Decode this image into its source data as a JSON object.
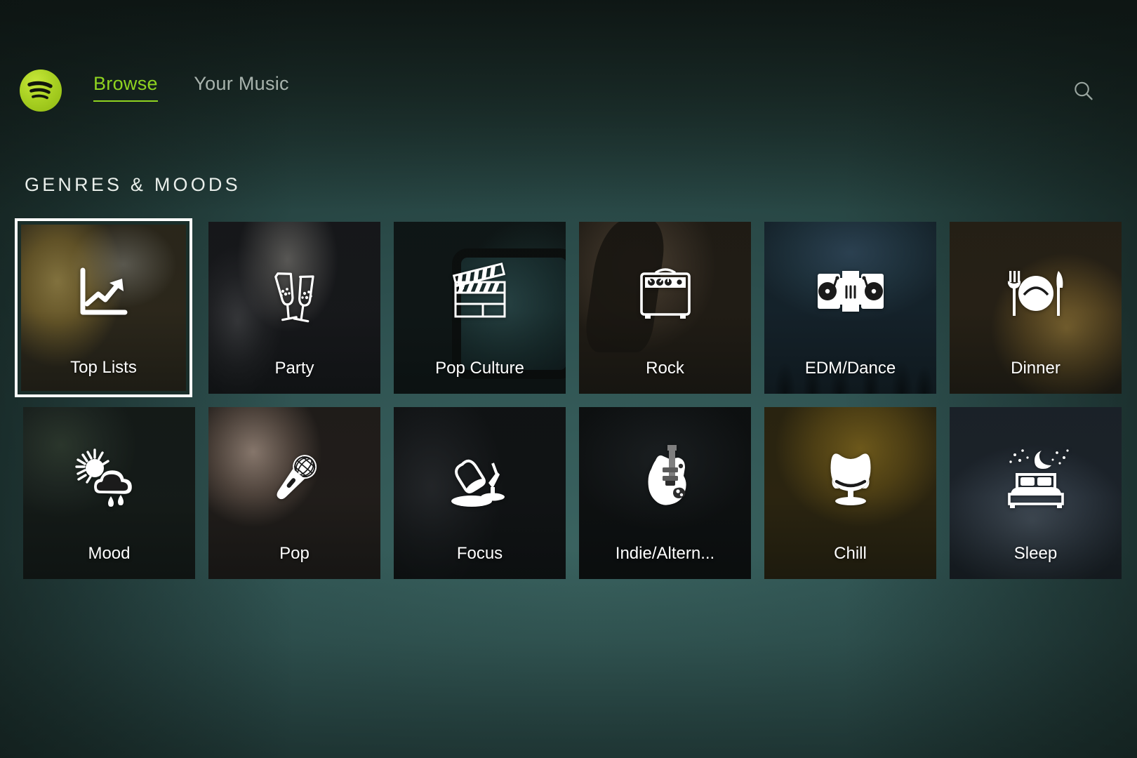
{
  "app": {
    "name": "Spotify",
    "logo_color": "#a8d022",
    "accent_color": "#8fd320",
    "background_color": "#2b4a46"
  },
  "header": {
    "logo_icon": "spotify-logo-icon",
    "nav": [
      {
        "label": "Browse",
        "active": true
      },
      {
        "label": "Your Music",
        "active": false
      }
    ],
    "search_icon": "search-icon"
  },
  "section": {
    "title": "GENRES & MOODS"
  },
  "grid": {
    "rows": [
      [
        {
          "label": "Top Lists",
          "icon": "chart-trend-up-icon",
          "photo": "ph-toplists",
          "selected": true
        },
        {
          "label": "Party",
          "icon": "champagne-glasses-icon",
          "photo": "ph-party",
          "selected": false
        },
        {
          "label": "Pop Culture",
          "icon": "clapperboard-icon",
          "photo": "ph-popculture",
          "selected": false
        },
        {
          "label": "Rock",
          "icon": "guitar-amp-icon",
          "photo": "ph-rock",
          "selected": false
        },
        {
          "label": "EDM/Dance",
          "icon": "dj-turntables-icon",
          "photo": "ph-edm",
          "selected": false
        },
        {
          "label": "Dinner",
          "icon": "fork-plate-knife-icon",
          "photo": "ph-dinner",
          "selected": false
        }
      ],
      [
        {
          "label": "Mood",
          "icon": "sun-cloud-rain-icon",
          "photo": "ph-mood",
          "selected": false
        },
        {
          "label": "Pop",
          "icon": "microphone-icon",
          "photo": "ph-pop",
          "selected": false
        },
        {
          "label": "Focus",
          "icon": "desk-lamp-icon",
          "photo": "ph-focus",
          "selected": false
        },
        {
          "label": "Indie/Altern...",
          "icon": "electric-guitar-icon",
          "photo": "ph-indie",
          "selected": false
        },
        {
          "label": "Chill",
          "icon": "lounge-chair-icon",
          "photo": "ph-chill",
          "selected": false
        },
        {
          "label": "Sleep",
          "icon": "bed-moon-stars-icon",
          "photo": "ph-sleep",
          "selected": false
        }
      ]
    ]
  }
}
